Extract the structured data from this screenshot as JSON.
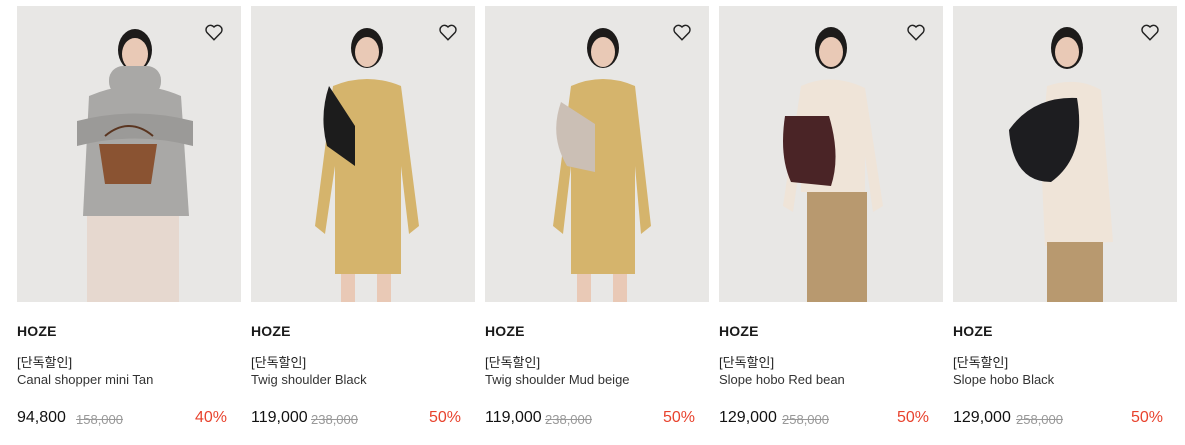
{
  "products": [
    {
      "brand": "HOZE",
      "tag": "[단독할인]",
      "name": "Canal shopper mini Tan",
      "price": "94,800",
      "original_price": "158,000",
      "discount": "40%",
      "top_color": "#a9a8a6",
      "bottom_color": "#e6d8cf",
      "bag_color": "#8a5332",
      "skin": "#e9c9b6"
    },
    {
      "brand": "HOZE",
      "tag": "[단독할인]",
      "name": "Twig shoulder Black",
      "price": "119,000",
      "original_price": "238,000",
      "discount": "50%",
      "top_color": "#d5b46c",
      "bottom_color": "#d5b46c",
      "bag_color": "#1c1c1c",
      "skin": "#e9c9b6"
    },
    {
      "brand": "HOZE",
      "tag": "[단독할인]",
      "name": "Twig shoulder Mud beige",
      "price": "119,000",
      "original_price": "238,000",
      "discount": "50%",
      "top_color": "#d5b46c",
      "bottom_color": "#d5b46c",
      "bag_color": "#cbbfb5",
      "skin": "#e9c9b6"
    },
    {
      "brand": "HOZE",
      "tag": "[단독할인]",
      "name": "Slope hobo Red bean",
      "price": "129,000",
      "original_price": "258,000",
      "discount": "50%",
      "top_color": "#efe4d8",
      "bottom_color": "#b8996f",
      "bag_color": "#4a2426",
      "skin": "#e9c9b6"
    },
    {
      "brand": "HOZE",
      "tag": "[단독할인]",
      "name": "Slope hobo Black",
      "price": "129,000",
      "original_price": "258,000",
      "discount": "50%",
      "top_color": "#efe4d8",
      "bottom_color": "#b8996f",
      "bag_color": "#1d1d20",
      "skin": "#e9c9b6"
    }
  ],
  "wishlist_icon": "heart-outline-icon"
}
